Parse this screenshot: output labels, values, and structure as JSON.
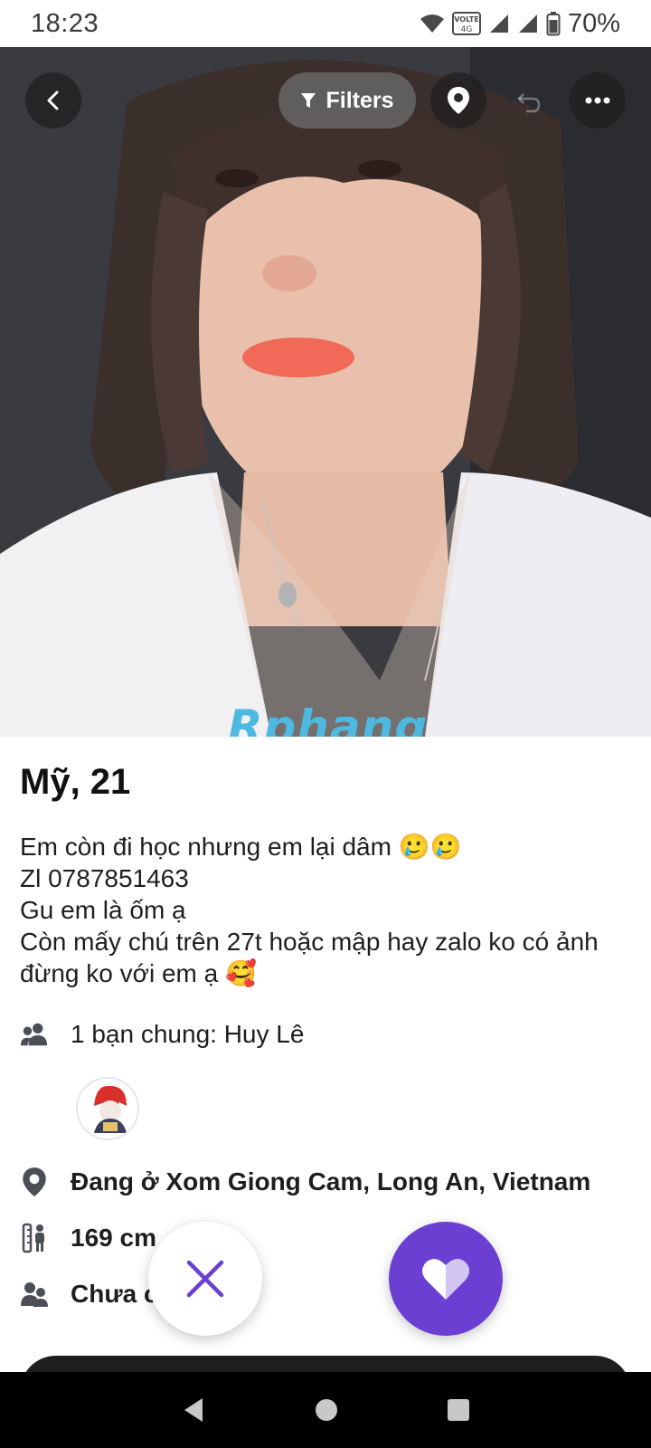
{
  "status_bar": {
    "time": "18:23",
    "network_badge": "VOLTE",
    "battery_percent": "70%",
    "icons": [
      "wifi-icon",
      "volte-icon",
      "signal-icon",
      "signal-icon",
      "battery-icon"
    ]
  },
  "top_bar": {
    "filters_label": "Filters",
    "icons": [
      "back-arrow-icon",
      "filter-icon",
      "location-pin-icon",
      "undo-icon",
      "more-icon"
    ]
  },
  "photo": {
    "watermark": "Rphang"
  },
  "profile": {
    "name_age": "Mỹ, 21",
    "bio_lines": [
      "Em còn đi học nhưng em lại dâm 🥲🥲",
      "Zl 0787851463",
      "Gu em là ốm ạ",
      "Còn mấy chú trên 27t hoặc mập hay zalo ko có ảnh",
      "đừng ko với em ạ 🥰"
    ],
    "mutual_friends": "1 bạn chung: Huy Lê",
    "location": "Đang ở Xom Giong Cam, Long An, Vietnam",
    "height": "169 cm",
    "relationship": "Chưa c"
  },
  "actions": {
    "pass_icon": "close-icon",
    "like_icon": "heart-icon"
  },
  "colors": {
    "accent": "#6a3fd1",
    "text": "#1c1e21",
    "watermark_blue": "#4db8e0",
    "watermark_red": "#e2403a"
  }
}
